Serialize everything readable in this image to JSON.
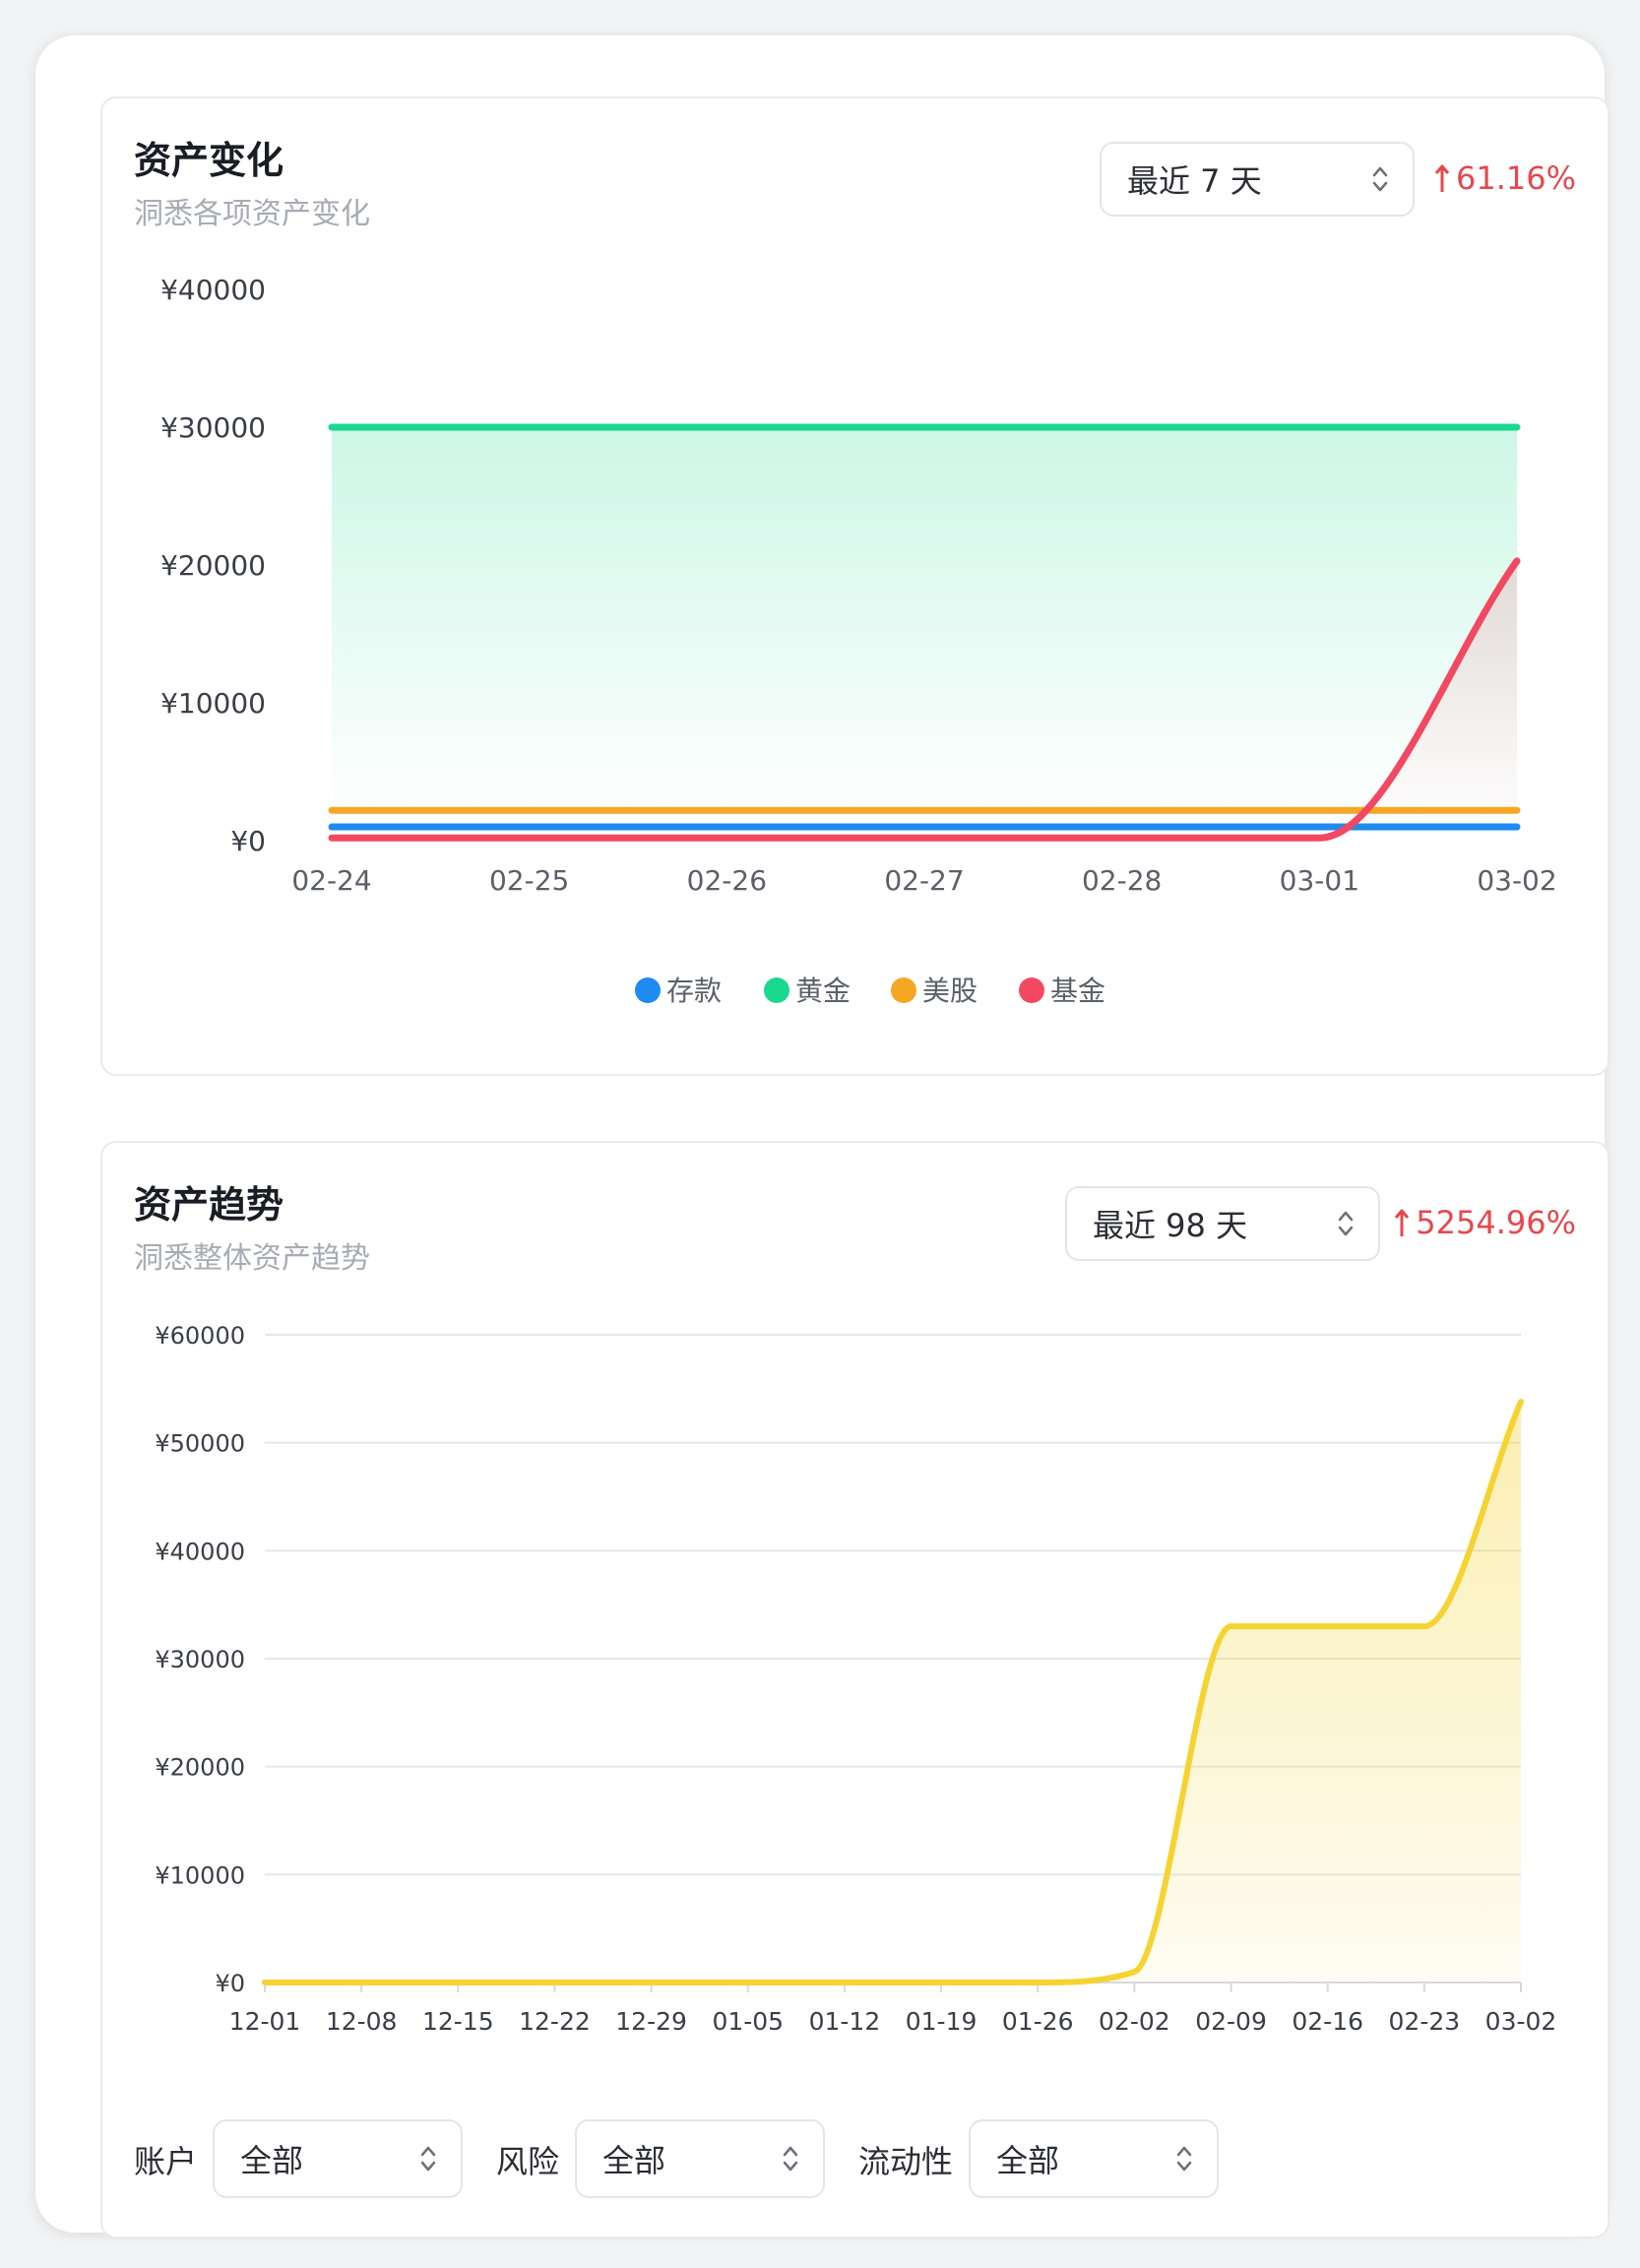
{
  "card1": {
    "title": "资产变化",
    "subtitle": "洞悉各项资产变化",
    "range_select": "最近 7 天",
    "change_pct": "61.16%"
  },
  "card2": {
    "title": "资产趋势",
    "subtitle": "洞悉整体资产趋势",
    "range_select": "最近 98 天",
    "change_pct": "5254.96%",
    "filters": [
      {
        "label": "账户",
        "value": "全部"
      },
      {
        "label": "风险",
        "value": "全部"
      },
      {
        "label": "流动性",
        "value": "全部"
      }
    ]
  },
  "colors": {
    "deposit": "#1e8bf0",
    "gold": "#19d98f",
    "us_stock": "#f5a623",
    "fund": "#f24862",
    "trend": "#f5d331",
    "up": "#e5484d"
  },
  "chart_data": [
    {
      "type": "line",
      "title": "资产变化",
      "x": [
        "02-24",
        "02-25",
        "02-26",
        "02-27",
        "02-28",
        "03-01",
        "03-02"
      ],
      "ylim": [
        0,
        40000
      ],
      "yticks": [
        "¥0",
        "¥10000",
        "¥20000",
        "¥30000",
        "¥40000"
      ],
      "ytick_values": [
        0,
        10000,
        20000,
        30000,
        40000
      ],
      "grid": false,
      "legend": "bottom-center",
      "series": [
        {
          "name": "存款",
          "color": "#1e8bf0",
          "values": [
            1000,
            1000,
            1000,
            1000,
            1000,
            1000,
            1000
          ]
        },
        {
          "name": "黄金",
          "color": "#19d98f",
          "values": [
            30000,
            30000,
            30000,
            30000,
            30000,
            30000,
            30000
          ],
          "area": true
        },
        {
          "name": "美股",
          "color": "#f5a623",
          "values": [
            2200,
            2200,
            2200,
            2200,
            2200,
            2200,
            2200
          ]
        },
        {
          "name": "基金",
          "color": "#f24862",
          "values": [
            200,
            200,
            200,
            200,
            200,
            200,
            20300
          ],
          "area": true
        }
      ]
    },
    {
      "type": "area",
      "title": "资产趋势",
      "x": [
        "12-01",
        "12-08",
        "12-15",
        "12-22",
        "12-29",
        "01-05",
        "01-12",
        "01-19",
        "01-26",
        "02-02",
        "02-09",
        "02-16",
        "02-23",
        "03-02"
      ],
      "ylim": [
        0,
        60000
      ],
      "yticks": [
        "¥0",
        "¥10000",
        "¥20000",
        "¥30000",
        "¥40000",
        "¥50000",
        "¥60000"
      ],
      "ytick_values": [
        0,
        10000,
        20000,
        30000,
        40000,
        50000,
        60000
      ],
      "grid": true,
      "series": [
        {
          "color": "#f5d331",
          "values": [
            0,
            0,
            0,
            0,
            0,
            0,
            0,
            0,
            0,
            1000,
            33000,
            33000,
            33000,
            53800
          ]
        }
      ]
    }
  ]
}
